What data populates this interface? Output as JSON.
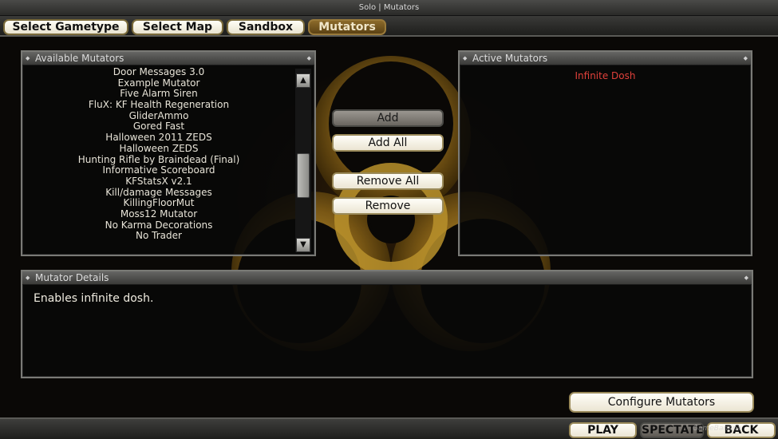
{
  "window": {
    "title": "Solo | Mutators"
  },
  "tabs": [
    {
      "label": "Select Gametype",
      "active": false
    },
    {
      "label": "Select Map",
      "active": false
    },
    {
      "label": "Sandbox",
      "active": false
    },
    {
      "label": "Mutators",
      "active": true
    }
  ],
  "available": {
    "title": "Available Mutators",
    "items": [
      "Door Messages 3.0",
      "Example Mutator",
      "Five Alarm Siren",
      "FluX: KF Health Regeneration",
      "GliderAmmo",
      "Gored Fast",
      "Halloween 2011 ZEDS",
      "Halloween ZEDS",
      "Hunting Rifle by Braindead (Final)",
      "Informative Scoreboard",
      "KFStatsX v2.1",
      "Kill/damage Messages",
      "KillingFloorMut",
      "Moss12 Mutator",
      "No Karma Decorations",
      "No Trader"
    ]
  },
  "active": {
    "title": "Active Mutators",
    "items": [
      "Infinite Dosh"
    ],
    "item_color": "#e0403a"
  },
  "buttons": {
    "add": "Add",
    "add_all": "Add All",
    "remove_all": "Remove All",
    "remove": "Remove"
  },
  "details": {
    "title": "Mutator Details",
    "text": "Enables infinite dosh."
  },
  "configure": "Configure Mutators",
  "bottom": {
    "play": "PLAY",
    "spectate": "SPECTATE",
    "back": "BACK",
    "watermark": "GameBanana"
  },
  "colors": {
    "accent": "#8b6a2a",
    "button_face": "#fffef8",
    "biohazard": "#c79a2a"
  }
}
